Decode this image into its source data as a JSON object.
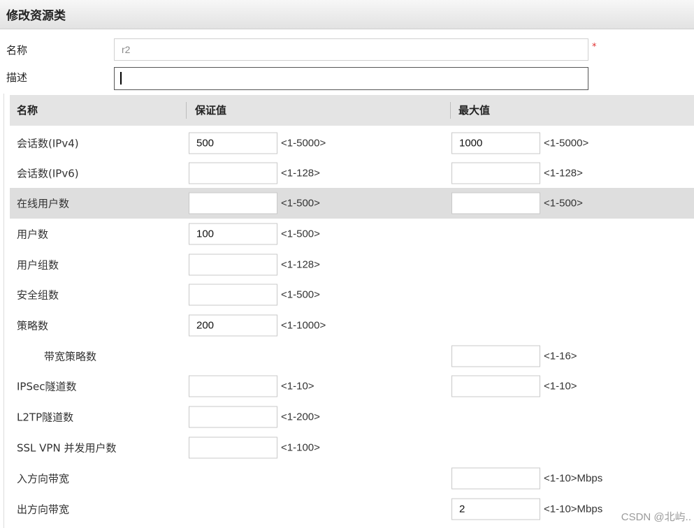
{
  "title": "修改资源类",
  "form": {
    "name_label": "名称",
    "name_value": "r2",
    "required_mark": "*",
    "desc_label": "描述",
    "desc_value": ""
  },
  "table": {
    "headers": {
      "name": "名称",
      "guaranteed": "保证值",
      "max": "最大值"
    },
    "rows": [
      {
        "name": "会话数(IPv4)",
        "guaranteed": {
          "value": "500",
          "range": "<1-5000>"
        },
        "max": {
          "value": "1000",
          "range": "<1-5000>"
        }
      },
      {
        "name": "会话数(IPv6)",
        "guaranteed": {
          "value": "",
          "range": "<1-128>"
        },
        "max": {
          "value": "",
          "range": "<1-128>"
        }
      },
      {
        "name": "在线用户数",
        "guaranteed": {
          "value": "",
          "range": "<1-500>"
        },
        "max": {
          "value": "",
          "range": "<1-500>"
        }
      },
      {
        "name": "用户数",
        "guaranteed": {
          "value": "100",
          "range": "<1-500>"
        }
      },
      {
        "name": "用户组数",
        "guaranteed": {
          "value": "",
          "range": "<1-128>"
        }
      },
      {
        "name": "安全组数",
        "guaranteed": {
          "value": "",
          "range": "<1-500>"
        }
      },
      {
        "name": "策略数",
        "guaranteed": {
          "value": "200",
          "range": "<1-1000>"
        }
      },
      {
        "name": "带宽策略数",
        "max": {
          "value": "",
          "range": "<1-16>"
        }
      },
      {
        "name": "IPSec隧道数",
        "guaranteed": {
          "value": "",
          "range": "<1-10>"
        },
        "max": {
          "value": "",
          "range": "<1-10>"
        }
      },
      {
        "name": "L2TP隧道数",
        "guaranteed": {
          "value": "",
          "range": "<1-200>"
        }
      },
      {
        "name": "SSL VPN 并发用户数",
        "guaranteed": {
          "value": "",
          "range": "<1-100>"
        }
      },
      {
        "name": "入方向带宽",
        "max": {
          "value": "",
          "range": "<1-10>Mbps"
        }
      },
      {
        "name": "出方向带宽",
        "max": {
          "value": "2",
          "range": "<1-10>Mbps"
        }
      }
    ]
  },
  "watermark": "CSDN @北屿.."
}
